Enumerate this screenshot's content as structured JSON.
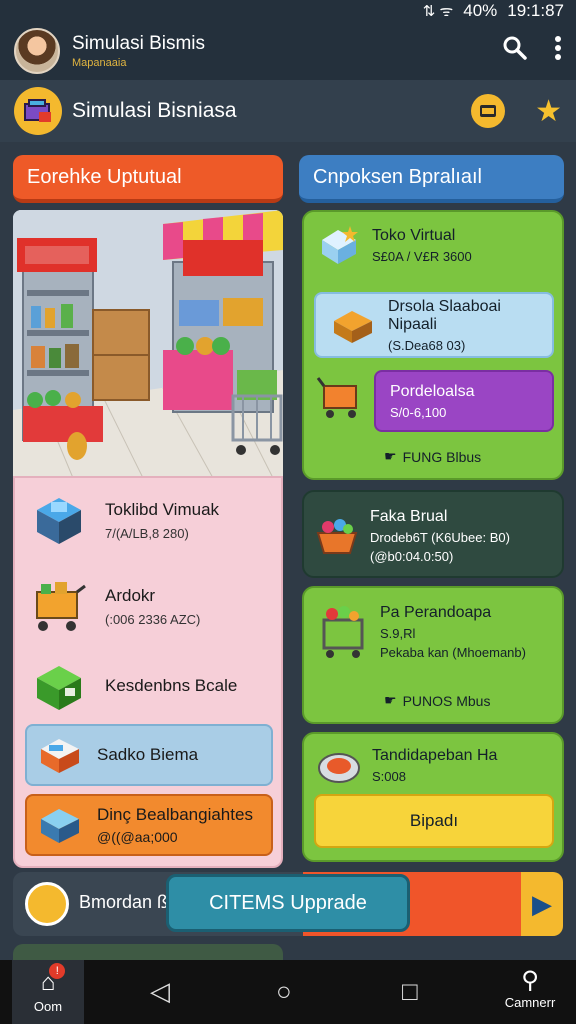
{
  "status_bar": {
    "icons": "⇅ ᯤ",
    "battery": "40%",
    "time": "19:1:87"
  },
  "app_bar": {
    "title": "Simulasi Bismis",
    "subtitle": "Mapanaaia",
    "icons": [
      "search-icon",
      "more-vert-icon"
    ]
  },
  "sub_header": {
    "title": "Simulasi Bisniasa"
  },
  "tabs": {
    "left": "Eorehke Uptutual",
    "right": "Cnpoksen Bpralıaıl"
  },
  "left_list": [
    {
      "title": "Toklibd Vimuak",
      "detail": "7/(A/LB,8 280)"
    },
    {
      "title": "Ardokr",
      "detail": "(:006 2336 AZC)"
    },
    {
      "title": "Kesdenbns Bcale",
      "detail": ""
    }
  ],
  "left_buttons": [
    {
      "label": "Sadko Biema",
      "detail": ""
    },
    {
      "label": "Dinç Bealbangiahtes",
      "detail": "@((@aa;000"
    }
  ],
  "right_cards": {
    "card1": {
      "title": "Toko Virtual",
      "detail": "S£0A / V£R 3600",
      "pill1_title": "Drsola Slaaboai Nipaali",
      "pill1_detail": "(S.Dea68 03)",
      "pill2_title": "Pordeloalsa",
      "pill2_detail": "S/0-6,100",
      "fund": "FUNG Blbus"
    },
    "card2": {
      "title": "Faka Brual",
      "line1": "Drodeb6T (K6Ubee: B0)",
      "line2": "(@b0:04.0:50)"
    },
    "card3": {
      "title": "Pa Perandoapa",
      "line1": "S.9,Rl",
      "line2": "Pekaba kan (Mhoemanb)",
      "fund": "PUNOS Mbus"
    },
    "card4": {
      "title": "Tandidapeban  Ha",
      "detail": "S:008",
      "button": "Bipadı"
    }
  },
  "bottom": {
    "label": "Bmordan ß",
    "upgrade": "CITEMS Upprade"
  },
  "nav": {
    "home_label": "Oom",
    "home_badge": "!",
    "camera_label": "Camnerr"
  },
  "colors": {
    "accent_orange": "#ee5a28",
    "accent_blue": "#3d7ec2",
    "card_green": "#7cc540",
    "pill_purple": "#9a45c4"
  }
}
